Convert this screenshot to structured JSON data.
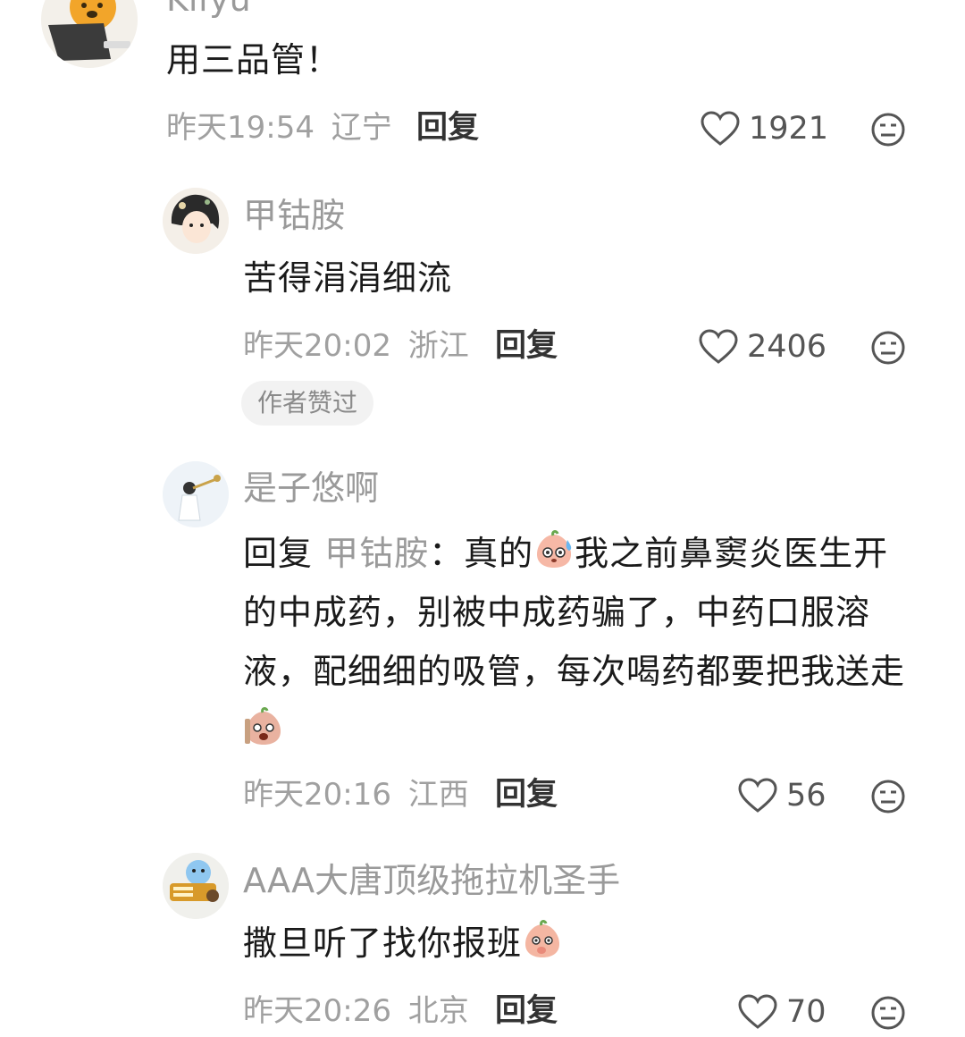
{
  "comments": [
    {
      "username": "Kifyu",
      "text": "用三品管！",
      "time": "昨天19:54",
      "region": "辽宁",
      "reply_label": "回复",
      "likes": "1921"
    },
    {
      "username": "甲钴胺",
      "text": "苦得涓涓细流",
      "time": "昨天20:02",
      "region": "浙江",
      "reply_label": "回复",
      "likes": "2406",
      "badge": "作者赞过"
    },
    {
      "username": "是子悠啊",
      "reply_prefix": "回复 ",
      "reply_to": "甲钴胺",
      "reply_colon": "：",
      "text_part1": "真的",
      "text_part2": "我之前鼻窦炎医生开的中成药，别被中成药骗了，中药口服溶液，配细细的吸管，每次喝药都要把我送走",
      "time": "昨天20:16",
      "region": "江西",
      "reply_label": "回复",
      "likes": "56"
    },
    {
      "username": "AAA大唐顶级拖拉机圣手",
      "text": "撒旦听了找你报班",
      "time": "昨天20:26",
      "region": "北京",
      "reply_label": "回复",
      "likes": "70"
    }
  ],
  "icons": {
    "like": "heart-outline-icon",
    "dislike": "meh-face-icon"
  },
  "colors": {
    "meta": "#a0a0a0",
    "username": "#9a9a9a",
    "text": "#1a1a1a",
    "badge_bg": "#f2f2f2"
  }
}
